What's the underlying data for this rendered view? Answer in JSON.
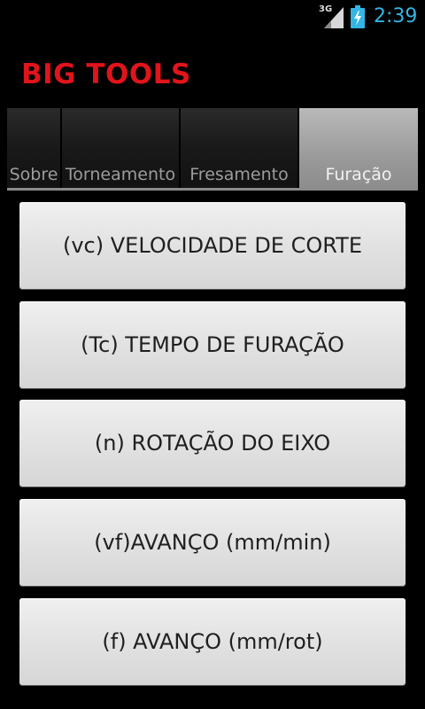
{
  "status_bar": {
    "network": "3G",
    "time": "2:39",
    "clock_color": "#33b5e5",
    "icons": [
      "signal-icon",
      "battery-charging-icon"
    ]
  },
  "app": {
    "title": "BIG TOOLS",
    "title_color": "#e0141b"
  },
  "tabs": [
    {
      "label": "Sobre",
      "selected": false
    },
    {
      "label": "Torneamento",
      "selected": false
    },
    {
      "label": "Fresamento",
      "selected": false
    },
    {
      "label": "Furação",
      "selected": true
    }
  ],
  "buttons": [
    {
      "label": "(vc) VELOCIDADE DE CORTE"
    },
    {
      "label": "(Tc) TEMPO DE FURAÇÃO"
    },
    {
      "label": "(n) ROTAÇÃO DO EIXO"
    },
    {
      "label": "(vf)AVANÇO (mm/min)"
    },
    {
      "label": "(f) AVANÇO (mm/rot)"
    }
  ]
}
